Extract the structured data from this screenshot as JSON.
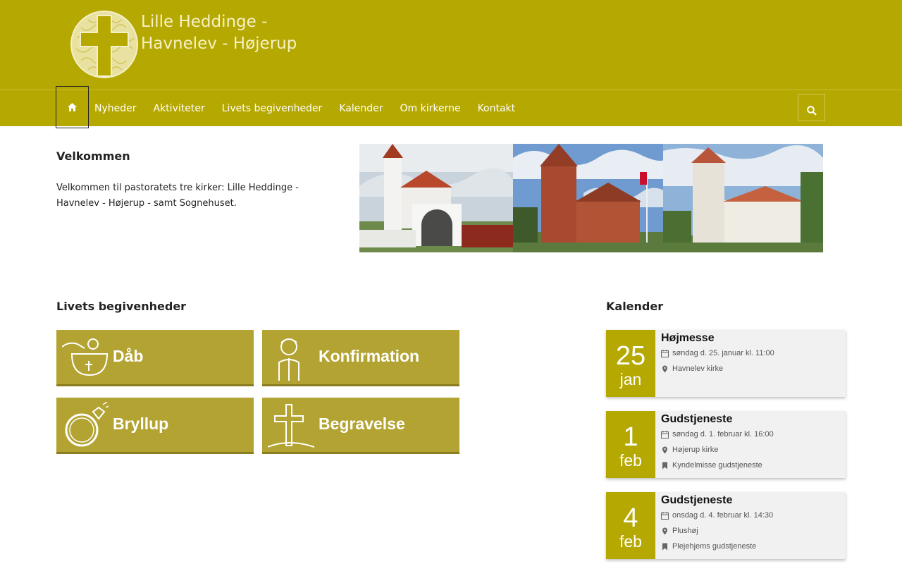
{
  "header": {
    "logo_line1": "Lille Heddinge -",
    "logo_line2": "Havnelev - Højerup"
  },
  "nav": {
    "items": [
      "Nyheder",
      "Aktiviteter",
      "Livets begivenheder",
      "Kalender",
      "Om kirkerne",
      "Kontakt"
    ]
  },
  "welcome": {
    "title": "Velkommen",
    "text": "Velkommen til pastoratets tre kirker: Lille Heddinge - Havnelev - Højerup - samt Sognehuset."
  },
  "life_events": {
    "title": "Livets begivenheder",
    "tiles": [
      "Dåb",
      "Konfirmation",
      "Bryllup",
      "Begravelse"
    ]
  },
  "calendar": {
    "title": "Kalender",
    "events": [
      {
        "day": "25",
        "month": "jan",
        "title": "Højmesse",
        "when": "søndag d. 25. januar kl. 11:00",
        "where": "Havnelev kirke",
        "tag": ""
      },
      {
        "day": "1",
        "month": "feb",
        "title": "Gudstjeneste",
        "when": "søndag d. 1. februar kl. 16:00",
        "where": "Højerup kirke",
        "tag": "Kyndelmisse gudstjeneste"
      },
      {
        "day": "4",
        "month": "feb",
        "title": "Gudstjeneste",
        "when": "onsdag d. 4. februar kl. 14:30",
        "where": "Plushøj",
        "tag": "Plejehjems gudstjeneste"
      }
    ]
  },
  "colors": {
    "brand": "#b5a800",
    "tile": "#b3a332"
  },
  "icons": {
    "home": "home-icon",
    "search": "search-icon",
    "calendar": "calendar-icon",
    "location": "map-pin-icon",
    "tag": "bookmark-icon"
  }
}
